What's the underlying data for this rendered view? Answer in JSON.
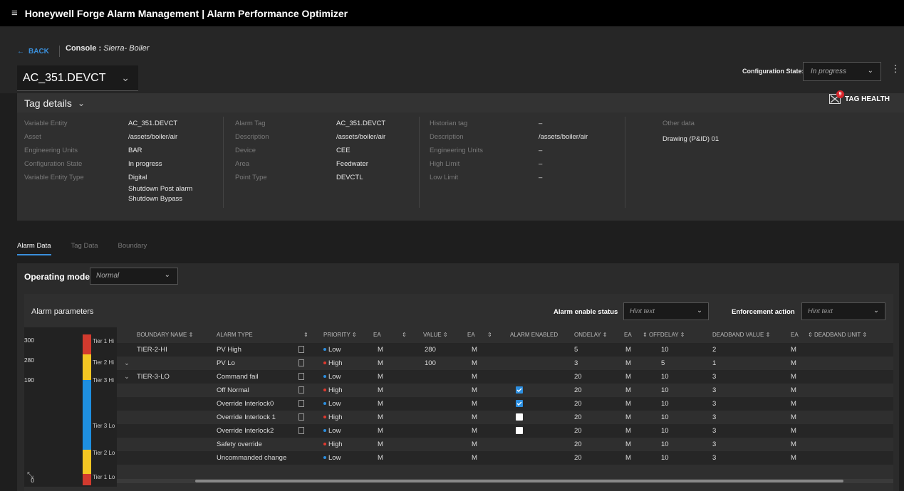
{
  "app": {
    "title": "Honeywell Forge Alarm Management | Alarm Performance Optimizer"
  },
  "nav": {
    "back_label": "BACK",
    "console_label": "Console :",
    "console_value": "Sierra- Boiler"
  },
  "tag": {
    "selected": "AC_351.DEVCT"
  },
  "config_state": {
    "label": "Configuration State:",
    "value": "In progress"
  },
  "tag_details": {
    "title": "Tag details",
    "tag_health_label": "TAG HEALTH",
    "tag_health_count": "9",
    "col1": [
      {
        "label": "Variable Entity",
        "value": "AC_351.DEVCT"
      },
      {
        "label": "Asset",
        "value": "/assets/boiler/air"
      },
      {
        "label": "Engineering Units",
        "value": "BAR"
      },
      {
        "label": "Configuration State",
        "value": "In progress"
      },
      {
        "label": "Variable Entity Type",
        "value": "Digital"
      }
    ],
    "col1_extra": [
      "Shutdown Post alarm",
      "Shutdown Bypass"
    ],
    "col2": [
      {
        "label": "Alarm Tag",
        "value": "AC_351.DEVCT"
      },
      {
        "label": "Description",
        "value": "/assets/boiler/air"
      },
      {
        "label": "Device",
        "value": "CEE"
      },
      {
        "label": "Area",
        "value": "Feedwater"
      },
      {
        "label": "Point Type",
        "value": "DEVCTL"
      }
    ],
    "col3": [
      {
        "label": "Historian tag",
        "value": "–"
      },
      {
        "label": "Description",
        "value": "/assets/boiler/air"
      },
      {
        "label": "Engineering Units",
        "value": "–"
      },
      {
        "label": "High Limit",
        "value": "–"
      },
      {
        "label": "Low Limit",
        "value": "–"
      }
    ],
    "other_label": "Other data",
    "other_value": "Drawing (P&ID) 01"
  },
  "tabs": [
    "Alarm Data",
    "Tag Data",
    "Boundary"
  ],
  "operating_mode": {
    "label": "Operating mode",
    "value": "Normal"
  },
  "alarm_params": {
    "title": "Alarm parameters",
    "enable_status_label": "Alarm enable status",
    "enable_status_placeholder": "Hint text",
    "enforcement_label": "Enforcement action",
    "enforcement_placeholder": "Hint text"
  },
  "boundary": {
    "values": [
      "300",
      "280",
      "190",
      "0"
    ],
    "labels": [
      "Tier 1 Hi",
      "Tier 2 Hi",
      "Tier 3 Hi",
      "Tier 3 Lo",
      "Tier 2 Lo",
      "Tier 1 Lo"
    ],
    "colors": {
      "red": "#d23a2e",
      "yellow": "#f3c623",
      "blue": "#1e8fe0"
    }
  },
  "table": {
    "headers": [
      "BOUNDARY NAME",
      "ALARM TYPE",
      "PRIORITY",
      "EA",
      "VALUE",
      "EA",
      "ALARM ENABLED",
      "ONDELAY",
      "EA",
      "OFFDELAY",
      "DEADBAND VALUE",
      "EA",
      "DEADBAND UNIT"
    ],
    "rows": [
      {
        "boundary": "TIER-2-HI",
        "type": "PV High",
        "priority": "Low",
        "ea1": "M",
        "value": "280",
        "ea2": "M",
        "enabled": "",
        "ondelay": "5",
        "ea3": "M",
        "offdelay": "10",
        "deadband": "2",
        "ea4": "M"
      },
      {
        "boundary": "",
        "type": "PV Lo",
        "priority": "High",
        "ea1": "M",
        "value": "100",
        "ea2": "M",
        "enabled": "",
        "ondelay": "3",
        "ea3": "M",
        "offdelay": "5",
        "deadband": "1",
        "ea4": "M"
      },
      {
        "boundary": "TIER-3-LO",
        "type": "Command fail",
        "priority": "Low",
        "ea1": "M",
        "value": "",
        "ea2": "M",
        "enabled": "",
        "ondelay": "20",
        "ea3": "M",
        "offdelay": "10",
        "deadband": "3",
        "ea4": "M"
      },
      {
        "boundary": "",
        "type": "Off Normal",
        "priority": "High",
        "ea1": "M",
        "value": "",
        "ea2": "M",
        "enabled": "checked",
        "ondelay": "20",
        "ea3": "M",
        "offdelay": "10",
        "deadband": "3",
        "ea4": "M"
      },
      {
        "boundary": "",
        "type": "Override Interlock0",
        "priority": "Low",
        "ea1": "M",
        "value": "",
        "ea2": "M",
        "enabled": "checked",
        "ondelay": "20",
        "ea3": "M",
        "offdelay": "10",
        "deadband": "3",
        "ea4": "M"
      },
      {
        "boundary": "",
        "type": "Override Interlock 1",
        "priority": "High",
        "ea1": "M",
        "value": "",
        "ea2": "M",
        "enabled": "unchecked",
        "ondelay": "20",
        "ea3": "M",
        "offdelay": "10",
        "deadband": "3",
        "ea4": "M"
      },
      {
        "boundary": "",
        "type": "Override Interlock2",
        "priority": "Low",
        "ea1": "M",
        "value": "",
        "ea2": "M",
        "enabled": "unchecked",
        "ondelay": "20",
        "ea3": "M",
        "offdelay": "10",
        "deadband": "3",
        "ea4": "M"
      },
      {
        "boundary": "",
        "type": "Safety override",
        "priority": "High",
        "ea1": "M",
        "value": "",
        "ea2": "M",
        "enabled": "",
        "ondelay": "20",
        "ea3": "M",
        "offdelay": "10",
        "deadband": "3",
        "ea4": "M"
      },
      {
        "boundary": "",
        "type": "Uncommanded change",
        "priority": "Low",
        "ea1": "M",
        "value": "",
        "ea2": "M",
        "enabled": "",
        "ondelay": "20",
        "ea3": "M",
        "offdelay": "10",
        "deadband": "3",
        "ea4": "M"
      }
    ]
  },
  "colors": {
    "accent": "#3a8fdb",
    "priority_low": "#2d8fe0",
    "priority_high": "#e0392f",
    "checkbox": "#2d8fe0"
  },
  "icons": [
    "menu-icon",
    "back-arrow-icon",
    "chevron-down-icon",
    "kebab-icon",
    "tag-health-icon",
    "document-icon",
    "expand-icon",
    "sort-icon"
  ]
}
